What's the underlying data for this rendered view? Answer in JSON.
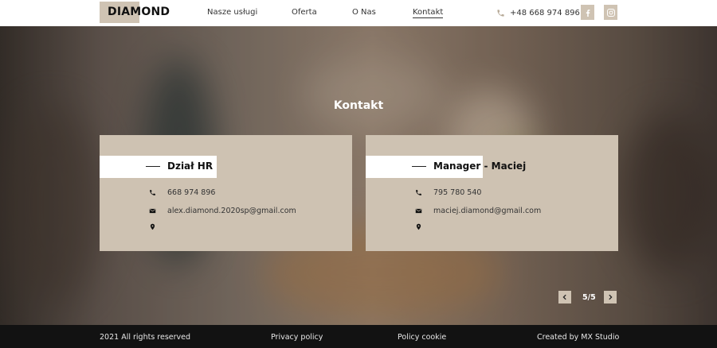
{
  "brand": {
    "logo_text": "DIAMOND",
    "accent": "#cfc3b3"
  },
  "nav": {
    "items": [
      {
        "label": "Nasze usługi"
      },
      {
        "label": "Oferta"
      },
      {
        "label": "O Nas"
      },
      {
        "label": "Kontakt",
        "active": true
      }
    ],
    "phone": "+48 668 974 896",
    "social": [
      "facebook-icon",
      "instagram-icon"
    ]
  },
  "hero": {
    "title": "Kontakt"
  },
  "cards": [
    {
      "name": "Dział HR",
      "phone": "668 974 896",
      "email": "alex.diamond.2020sp@gmail.com",
      "address": ""
    },
    {
      "name": "Manager - Maciej",
      "phone": "795 780 540",
      "email": "maciej.diamond@gmail.com",
      "address": ""
    }
  ],
  "pager": {
    "count": "5/5"
  },
  "footer": {
    "copyright": "2021 All rights reserved",
    "privacy": "Privacy policy",
    "cookie": "Policy cookie",
    "credit": "Created by MX Studio"
  }
}
